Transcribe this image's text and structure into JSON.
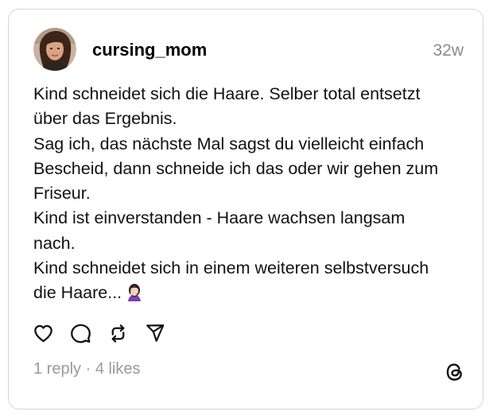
{
  "post": {
    "username": "cursing_mom",
    "timestamp": "32w",
    "text_lines": [
      "Kind schneidet sich die Haare. Selber total entsetzt",
      "über das Ergebnis.",
      "Sag ich, das nächste Mal sagst du vielleicht einfach",
      "Bescheid, dann schneide ich das oder wir gehen zum",
      "Friseur.",
      "Kind ist einverstanden - Haare wachsen langsam",
      "nach.",
      "Kind schneidet sich in einem weiteren selbstversuch",
      "die Haare..."
    ],
    "emoji": "facepalm-woman-emoji"
  },
  "actions": {
    "like_icon": "heart-icon",
    "comment_icon": "comment-icon",
    "repost_icon": "repost-icon",
    "share_icon": "send-icon"
  },
  "stats": {
    "replies": "1 reply",
    "separator": " · ",
    "likes": "4 likes"
  },
  "brand": {
    "logo_icon": "threads-logo-icon",
    "text_color": "#111111",
    "muted_color": "#9a9a9a",
    "border_color": "#d6d6d6"
  }
}
